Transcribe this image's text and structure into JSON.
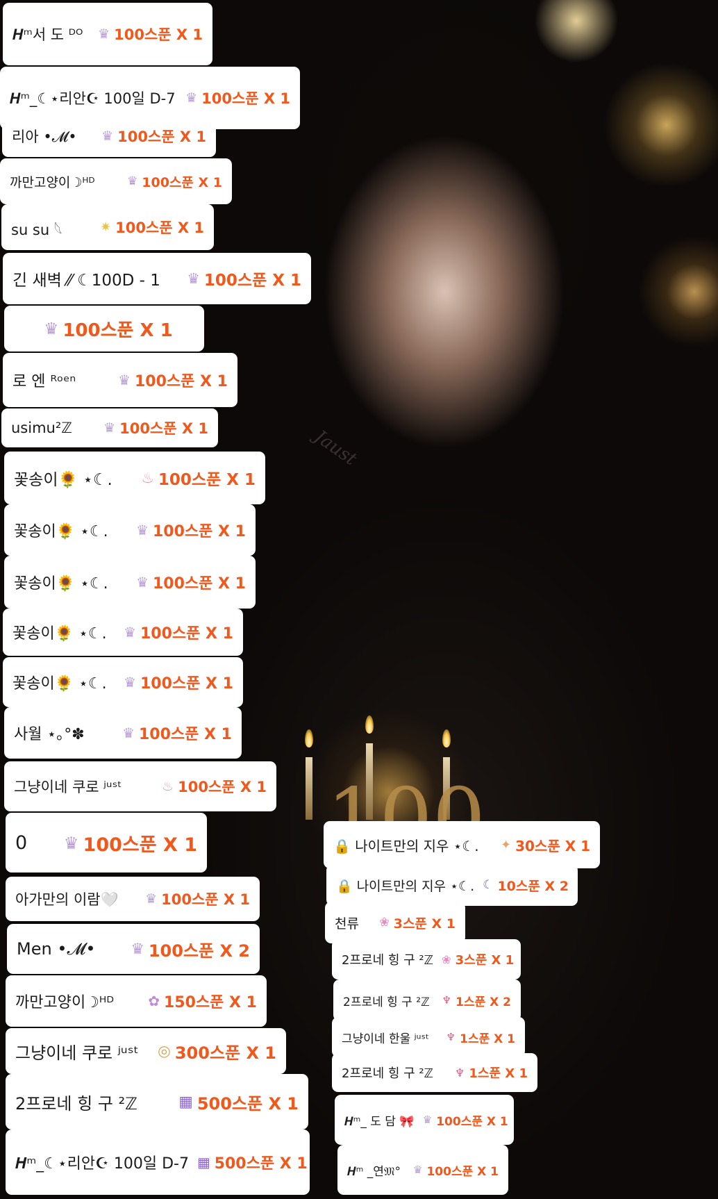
{
  "background": {
    "tattoo_text": "Jaust",
    "cake_number": "100"
  },
  "gifts": [
    {
      "user": "𝑯ᵐ서 도 ᴰᴼ",
      "icon": "crown-icon",
      "gift": "100스푼 X 1"
    },
    {
      "user": "𝑯ᵐ_☾⋆리안☪ 100일 D-7",
      "icon": "crown-icon",
      "gift": "100스푼 X 1"
    },
    {
      "user": "리아 •𝓜•",
      "icon": "crown-icon",
      "gift": "100스푼 X 1"
    },
    {
      "user": "까만고양이☽ᴴᴰ",
      "icon": "crown-icon",
      "gift": "100스푼 X 1"
    },
    {
      "user": "su su 𓆩",
      "icon": "sparkle-icon",
      "gift": "100스푼 X 1"
    },
    {
      "user": "긴 새벽 ⁄⁄ ☾100D - 1",
      "icon": "crown-icon",
      "gift": "100스푼 X 1"
    },
    {
      "user": "",
      "icon": "crown-icon",
      "gift": "100스푼 X 1"
    },
    {
      "user": "로 엔 ᴿᵒᵉⁿ",
      "icon": "crown-icon",
      "gift": "100스푼 X 1"
    },
    {
      "user": "usimu²ℤ",
      "icon": "crown-icon",
      "gift": "100스푼 X 1"
    },
    {
      "user": "꽃송이🌻 ⋆☾.",
      "icon": "cake-icon",
      "gift": "100스푼 X 1"
    },
    {
      "user": "꽃송이🌻 ⋆☾.",
      "icon": "crown-icon",
      "gift": "100스푼 X 1"
    },
    {
      "user": "꽃송이🌻 ⋆☾.",
      "icon": "crown-icon",
      "gift": "100스푼 X 1"
    },
    {
      "user": "꽃송이🌻 ⋆☾.",
      "icon": "crown-icon",
      "gift": "100스푼 X 1"
    },
    {
      "user": "꽃송이🌻 ⋆☾.",
      "icon": "crown-icon",
      "gift": "100스푼 X 1"
    },
    {
      "user": "사월 ⋆｡°✽",
      "icon": "crown-icon",
      "gift": "100스푼 X 1"
    },
    {
      "user": "그냥이네 쿠로 ʲᵘˢᵗ",
      "icon": "cake-icon",
      "gift": "100스푼 X 1"
    },
    {
      "user": "0",
      "icon": "crown-icon",
      "gift": "100스푼 X 1"
    },
    {
      "user": "아가만의 이람🤍",
      "icon": "crown-icon",
      "gift": "100스푼 X 1"
    },
    {
      "user": "Men •𝓜•",
      "icon": "crown-icon",
      "gift": "100스푼 X 2"
    },
    {
      "user": "까만고양이☽ᴴᴰ",
      "icon": "bouquet-icon",
      "gift": "150스푼 X 1"
    },
    {
      "user": "그냥이네 쿠로 ʲᵘˢᵗ",
      "icon": "ring-icon",
      "gift": "300스푼 X 1"
    },
    {
      "user": "2프로네 힝 구  ²ℤ",
      "icon": "galaxy-icon",
      "gift": "500스푼 X 1"
    },
    {
      "user": "𝑯ᵐ_☾⋆리안☪ 100일 D-7",
      "icon": "galaxy-icon",
      "gift": "500스푼 X 1"
    },
    {
      "user": "🔒 나이트만의 지우 ⋆☾.",
      "icon": "angel-icon",
      "gift": "30스푼 X 1"
    },
    {
      "user": "🔒 나이트만의 지우 ⋆☾.",
      "icon": "moon-icon",
      "gift": "10스푼 X 2"
    },
    {
      "user": "천류",
      "icon": "flower-icon",
      "gift": "3스푼 X 1"
    },
    {
      "user": "2프로네 힝 구  ²ℤ",
      "icon": "flower-icon",
      "gift": "3스푼 X 1"
    },
    {
      "user": "2프로네 힝 구  ²ℤ",
      "icon": "cocktail-icon",
      "gift": "1스푼 X 2"
    },
    {
      "user": "그냥이네 한울 ʲᵘˢᵗ",
      "icon": "cocktail-icon",
      "gift": "1스푼 X 1"
    },
    {
      "user": "2프로네 힝 구  ²ℤ",
      "icon": "cocktail-icon",
      "gift": "1스푼 X 1"
    },
    {
      "user": "𝑯ᵐ_ 도 담 🎀",
      "icon": "crown-icon",
      "gift": "100스푼 X 1"
    },
    {
      "user": "𝑯ᵐ _연𝔐°",
      "icon": "crown-icon",
      "gift": "100스푼 X 1"
    }
  ],
  "colors": {
    "gift_text": "#f0581c",
    "card_bg": "#ffffff",
    "user_text": "#1b1b1b",
    "crown_icon": "#b79ad6"
  }
}
